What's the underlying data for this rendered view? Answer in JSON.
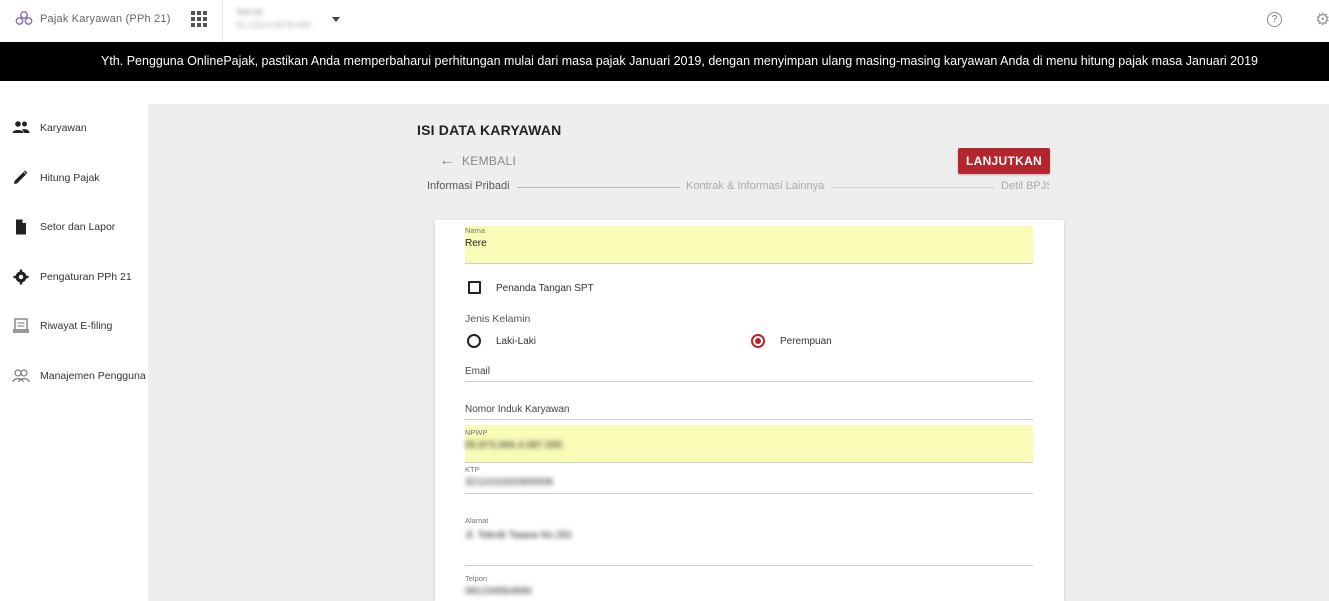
{
  "topbar": {
    "app_name": "Pajak Karyawan (PPh 21)",
    "company_name": "TeknIK",
    "company_npwp": "01.123.4.5678.000"
  },
  "banner": {
    "text": "Yth. Pengguna OnlinePajak, pastikan Anda memperbaharui perhitungan mulai dari masa pajak Januari 2019, dengan menyimpan ulang masing-masing karyawan Anda di menu hitung pajak masa Januari 2019"
  },
  "sidebar": {
    "items": [
      {
        "label": "Karyawan",
        "icon": "people-icon"
      },
      {
        "label": "Hitung Pajak",
        "icon": "pencil-icon"
      },
      {
        "label": "Setor dan Lapor",
        "icon": "document-icon"
      },
      {
        "label": "Pengaturan PPh 21",
        "icon": "gear-icon"
      },
      {
        "label": "Riwayat E-filing",
        "icon": "history-icon"
      },
      {
        "label": "Manajemen Pengguna",
        "icon": "users-manage-icon"
      }
    ]
  },
  "page": {
    "title": "ISI DATA KARYAWAN",
    "back_label": "KEMBALI",
    "next_label": "LANJUTKAN"
  },
  "stepper": {
    "steps": [
      "Informasi Pribadi",
      "Kontrak & Informasi Lainnya",
      "Detil BPJS"
    ]
  },
  "form": {
    "nama": {
      "label": "Nama",
      "value": "Rere"
    },
    "signer_checkbox_label": "Penanda Tangan SPT",
    "gender": {
      "label": "Jenis Kelamin",
      "options": [
        "Laki-Laki",
        "Perempuan"
      ],
      "selected": "Perempuan"
    },
    "email_label": "Email",
    "nik_label": "Nomor Induk Karyawan",
    "npwp": {
      "label": "NPWP",
      "value": "05.873.066.4.087.000"
    },
    "ktp": {
      "label": "KTP",
      "value": "3211010202900006"
    },
    "alamat": {
      "label": "Alamat",
      "value": "Jl. Teknik Taawa No.281"
    },
    "telpon": {
      "label": "Telpon",
      "value": "081234564890"
    }
  },
  "colors": {
    "accent": "#b3262d",
    "banner_bg": "#000000",
    "highlight": "#f8fcb7",
    "content_bg": "#eeeeee"
  }
}
